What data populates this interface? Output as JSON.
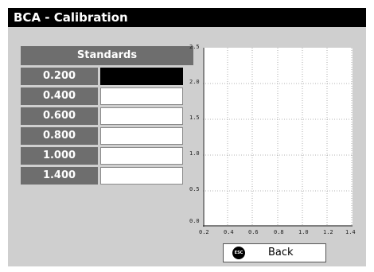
{
  "window": {
    "title": "BCA - Calibration"
  },
  "standards": {
    "header": "Standards",
    "rows": [
      {
        "label": "0.200",
        "value": "",
        "selected": true
      },
      {
        "label": "0.400",
        "value": ""
      },
      {
        "label": "0.600",
        "value": ""
      },
      {
        "label": "0.800",
        "value": ""
      },
      {
        "label": "1.000",
        "value": ""
      },
      {
        "label": "1.400",
        "value": ""
      }
    ]
  },
  "plot": {
    "y_ticks": [
      "2.5",
      "2.0",
      "1.5",
      "1.0",
      "0.5",
      "0.0"
    ],
    "x_ticks": [
      "0.2",
      "0.4",
      "0.6",
      "0.8",
      "1.0",
      "1.2",
      "1.4"
    ],
    "grid": "dotted",
    "points": []
  },
  "back_button": {
    "icon": "esc-icon",
    "icon_text": "ESC",
    "label": "Back"
  }
}
